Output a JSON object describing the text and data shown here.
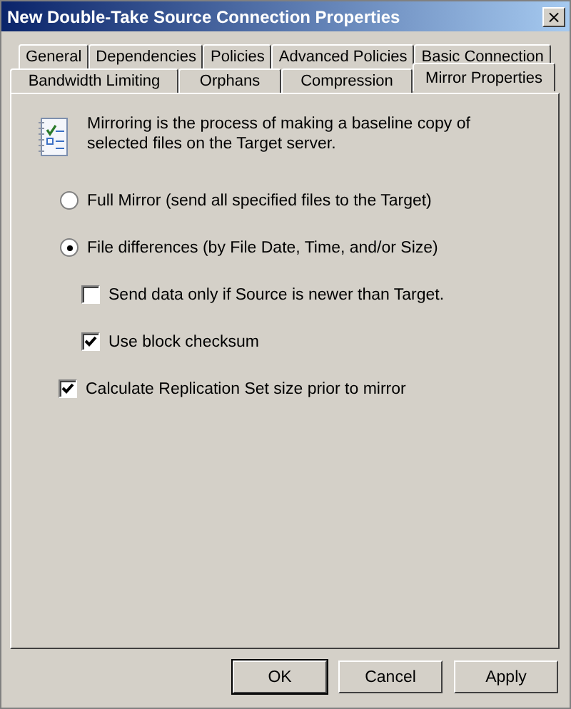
{
  "window": {
    "title": "New Double-Take Source Connection Properties",
    "close_label": "×"
  },
  "tab_rows": [
    {
      "tabs": [
        {
          "label": "General",
          "selected": false
        },
        {
          "label": "Dependencies",
          "selected": false
        },
        {
          "label": "Policies",
          "selected": false
        },
        {
          "label": "Advanced Policies",
          "selected": false
        },
        {
          "label": "Basic Connection",
          "selected": false
        }
      ]
    },
    {
      "tabs": [
        {
          "label": "Bandwidth Limiting",
          "selected": false
        },
        {
          "label": "Orphans",
          "selected": false
        },
        {
          "label": "Compression",
          "selected": false
        },
        {
          "label": "Mirror Properties",
          "selected": true
        }
      ]
    }
  ],
  "description": "Mirroring is the process of making a baseline copy of selected files on the Target server.",
  "options": [
    {
      "kind": "radio",
      "label": "Full Mirror (send all specified files to the Target)",
      "selected": false
    },
    {
      "kind": "radio",
      "label": "File differences (by File Date, Time, and/or Size)",
      "selected": true,
      "children": [
        {
          "kind": "checkbox",
          "label": "Send data only if Source is newer than Target.",
          "checked": false
        },
        {
          "kind": "checkbox",
          "label": "Use block checksum",
          "checked": true
        }
      ]
    },
    {
      "kind": "checkbox",
      "label": "Calculate Replication Set size prior to mirror",
      "checked": true
    }
  ],
  "buttons": [
    "OK",
    "Cancel",
    "Apply"
  ]
}
